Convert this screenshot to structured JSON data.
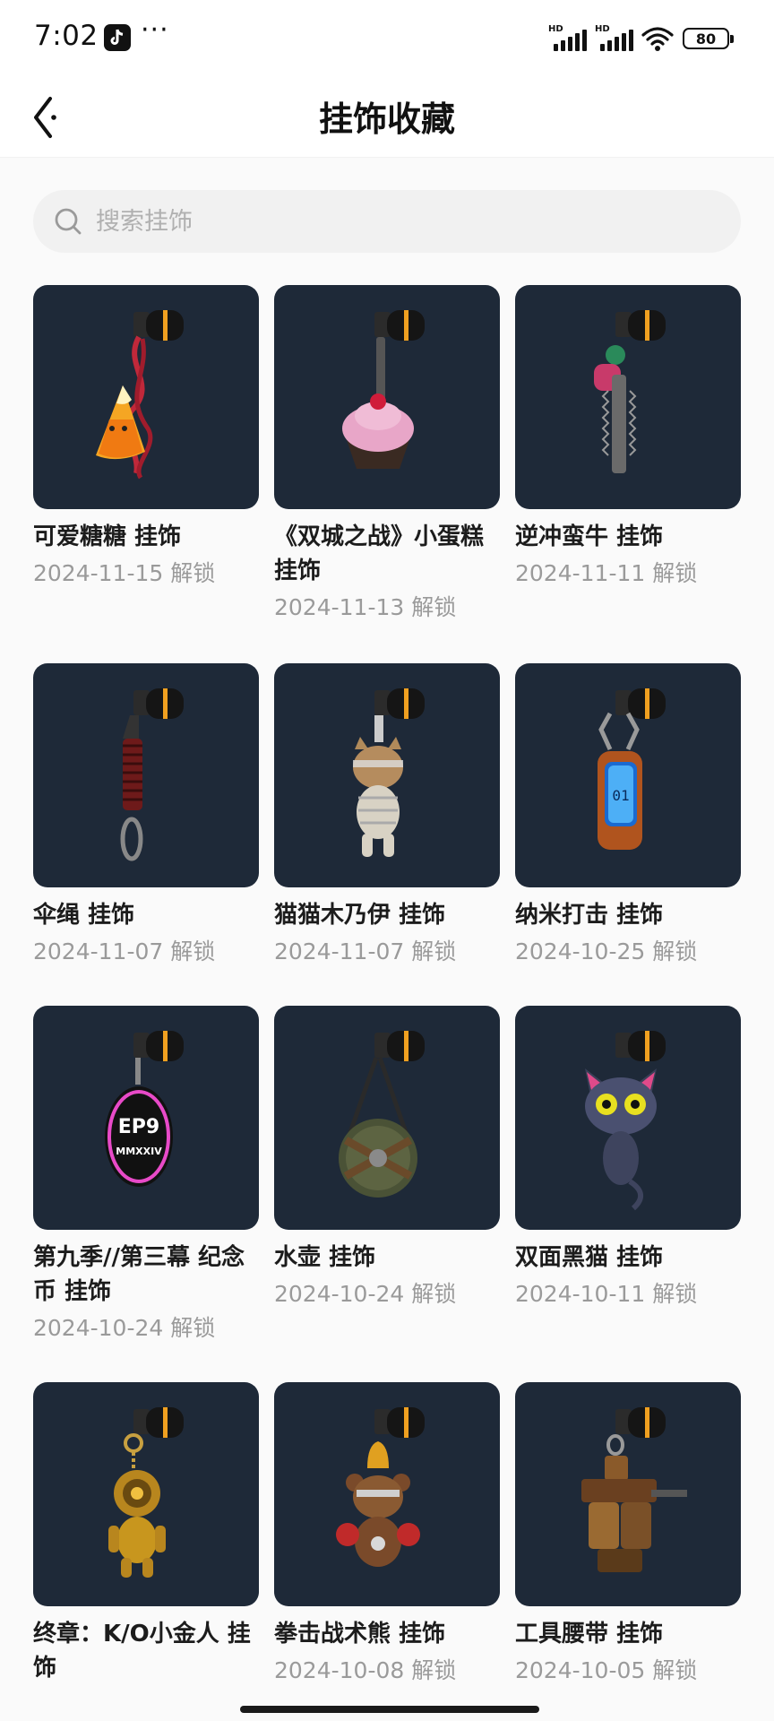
{
  "status_bar": {
    "time": "7:02",
    "more": "···",
    "battery": "80"
  },
  "header": {
    "title": "挂饰收藏"
  },
  "search": {
    "placeholder": "搜索挂饰"
  },
  "items": [
    {
      "name": "可爱糖糖 挂饰",
      "date": "2024-11-15 解锁",
      "icon": "candy-corn-charm"
    },
    {
      "name": "《双城之战》小蛋糕 挂饰",
      "date": "2024-11-13 解锁",
      "icon": "cupcake-charm"
    },
    {
      "name": "逆冲蛮牛 挂饰",
      "date": "2024-11-11 解锁",
      "icon": "chainsaw-charm"
    },
    {
      "name": "伞绳 挂饰",
      "date": "2024-11-07 解锁",
      "icon": "paracord-charm"
    },
    {
      "name": "猫猫木乃伊 挂饰",
      "date": "2024-11-07 解锁",
      "icon": "mummy-cat-charm"
    },
    {
      "name": "纳米打击 挂饰",
      "date": "2024-10-25 解锁",
      "icon": "nano-strike-charm"
    },
    {
      "name": "第九季//第三幕 纪念币 挂饰",
      "date": "2024-10-24 解锁",
      "icon": "coin-charm",
      "coin_text": [
        "EP9",
        "MMXXIV"
      ]
    },
    {
      "name": "水壶 挂饰",
      "date": "2024-10-24 解锁",
      "icon": "canteen-charm"
    },
    {
      "name": "双面黑猫 挂饰",
      "date": "2024-10-11 解锁",
      "icon": "black-cat-charm"
    },
    {
      "name": "终章：K/O小金人 挂饰",
      "date": "",
      "icon": "golden-figure-charm"
    },
    {
      "name": "拳击战术熊 挂饰",
      "date": "2024-10-08 解锁",
      "icon": "boxing-bear-charm"
    },
    {
      "name": "工具腰带 挂饰",
      "date": "2024-10-05 解锁",
      "icon": "tool-belt-charm"
    }
  ],
  "colors": {
    "tile_bg": "#1e2938",
    "clip_orange": "#f0a020",
    "date_gray": "#9a9a9a"
  }
}
